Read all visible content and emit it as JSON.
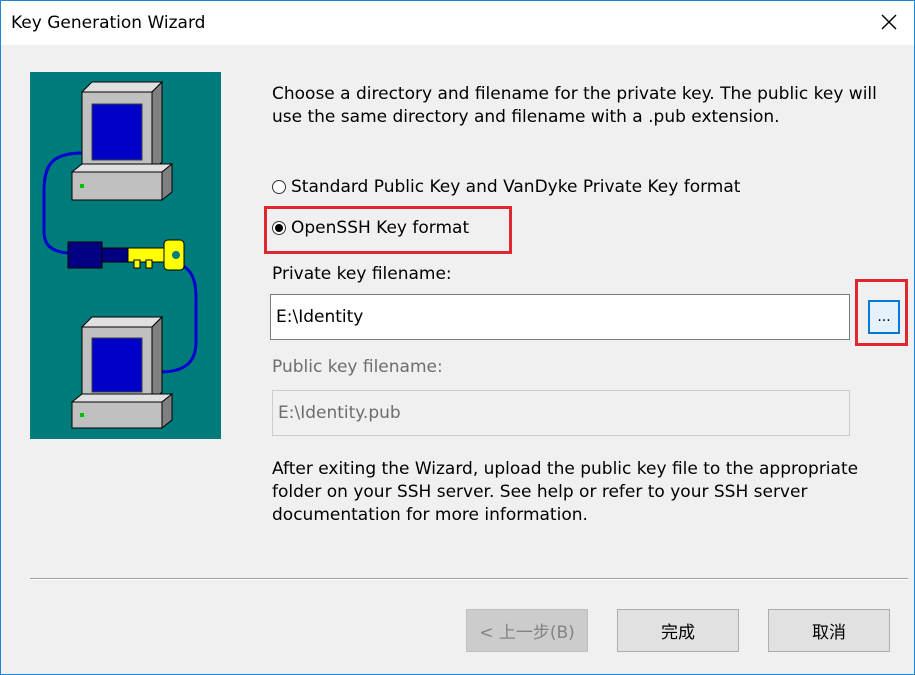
{
  "window": {
    "title": "Key Generation Wizard"
  },
  "intro": "Choose a directory and filename for the private key. The public key will use the same directory and filename with a .pub extension.",
  "format_options": [
    {
      "label": "Standard Public Key and VanDyke Private Key format",
      "selected": false
    },
    {
      "label": "OpenSSH Key format",
      "selected": true
    }
  ],
  "private_key": {
    "label": "Private key filename:",
    "value": "E:\\Identity",
    "browse_label": "..."
  },
  "public_key": {
    "label": "Public key filename:",
    "value": "E:\\Identity.pub"
  },
  "footer_note": "After exiting the Wizard, upload the public key file to the appropriate folder on your SSH server.  See help or refer to your SSH server documentation for more information.",
  "buttons": {
    "back": "< 上一步(B)",
    "finish": "完成",
    "cancel": "取消"
  },
  "colors": {
    "illustration_bg": "#007b7b",
    "highlight": "#e0262e",
    "focus": "#0078d7"
  },
  "icons": {
    "close": "close-icon",
    "illustration": "computers-key-illustration"
  }
}
